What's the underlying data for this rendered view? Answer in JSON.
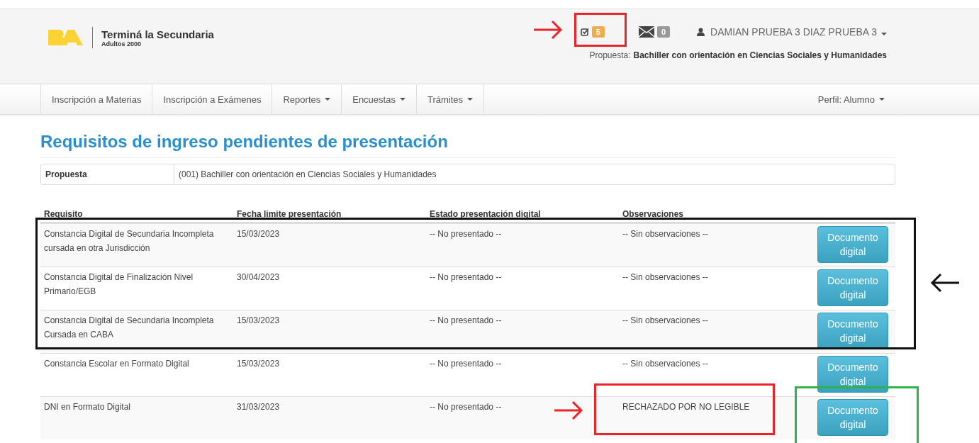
{
  "header": {
    "brand": {
      "title": "Terminá la Secundaria",
      "subtitle": "Adultos 2000"
    },
    "tasks_badge": "5",
    "messages_badge": "0",
    "user": "DAMIAN PRUEBA 3 DIAZ PRUEBA 3",
    "propuesta_label": "Propuesta:",
    "propuesta_value": "Bachiller con orientación en Ciencias Sociales y Humanidades"
  },
  "nav": {
    "items": [
      {
        "label": "Inscripción a Materias",
        "dropdown": false
      },
      {
        "label": "Inscripción a Exámenes",
        "dropdown": false
      },
      {
        "label": "Reportes",
        "dropdown": true
      },
      {
        "label": "Encuestas",
        "dropdown": true
      },
      {
        "label": "Trámites",
        "dropdown": true
      }
    ],
    "profile": "Perfil: Alumno"
  },
  "page_title": "Requisitos de ingreso pendientes de presentación",
  "propuesta_row": {
    "label": "Propuesta",
    "value": "(001) Bachiller con orientación en Ciencias Sociales y Humanidades"
  },
  "table": {
    "columns": [
      "Requisito",
      "Fecha limite presentación",
      "Estado presentación digital",
      "Observaciones"
    ],
    "rows": [
      {
        "requisito": "Constancia Digital de Secundaria Incompleta cursada en otra Jurisdicción",
        "fecha": "15/03/2023",
        "estado": "-- No presentado --",
        "observaciones": "-- Sin observaciones --",
        "action": "Documento digital"
      },
      {
        "requisito": "Constancia Digital de Finalización Nivel Primario/EGB",
        "fecha": "30/04/2023",
        "estado": "-- No presentado --",
        "observaciones": "-- Sin observaciones --",
        "action": "Documento digital"
      },
      {
        "requisito": "Constancia Digital de Secundaria Incompleta Cursada en CABA",
        "fecha": "15/03/2023",
        "estado": "-- No presentado --",
        "observaciones": "-- Sin observaciones --",
        "action": "Documento digital"
      },
      {
        "requisito": "Constancia Escolar en Formato Digital",
        "fecha": "15/03/2023",
        "estado": "-- No presentado --",
        "observaciones": "-- Sin observaciones --",
        "action": "Documento digital"
      },
      {
        "requisito": "DNI en Formato Digital",
        "fecha": "31/03/2023",
        "estado": "-- No presentado --",
        "observaciones": "RECHAZADO POR NO LEGIBLE",
        "action": "Documento digital"
      }
    ]
  },
  "annotations": [
    {
      "kind": "box",
      "color": "#e8262a"
    },
    {
      "kind": "arrow",
      "color": "#e8262a"
    },
    {
      "kind": "box",
      "color": "#111111"
    },
    {
      "kind": "arrow",
      "color": "#111111"
    },
    {
      "kind": "box",
      "color": "#e8262a"
    },
    {
      "kind": "arrow",
      "color": "#e8262a"
    },
    {
      "kind": "box",
      "color": "#2fb24a"
    }
  ]
}
